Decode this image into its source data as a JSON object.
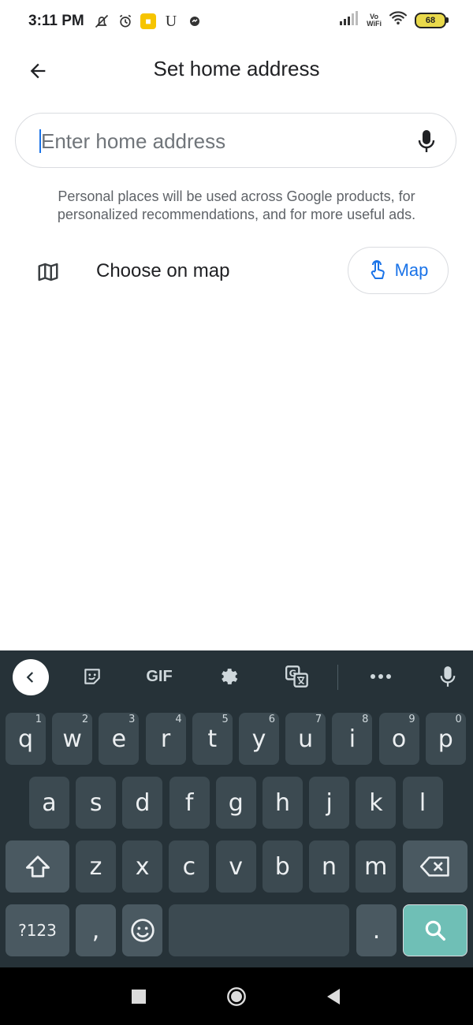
{
  "status_bar": {
    "time": "3:11 PM",
    "left_icons": [
      "mute-icon",
      "alarm-icon",
      "notification-icon",
      "u-icon",
      "messenger-icon"
    ],
    "vo_wifi_top": "Vo",
    "vo_wifi_bottom": "WiFi",
    "battery": "68"
  },
  "header": {
    "title": "Set home address"
  },
  "search": {
    "placeholder": "Enter home address",
    "value": ""
  },
  "disclaimer": "Personal places will be used across Google products, for personalized recommendations, and for more useful ads.",
  "choose_on_map": {
    "label": "Choose on map",
    "button_label": "Map"
  },
  "keyboard": {
    "toolbar": {
      "gif": "GIF"
    },
    "row1": [
      {
        "k": "q",
        "h": "1"
      },
      {
        "k": "w",
        "h": "2"
      },
      {
        "k": "e",
        "h": "3"
      },
      {
        "k": "r",
        "h": "4"
      },
      {
        "k": "t",
        "h": "5"
      },
      {
        "k": "y",
        "h": "6"
      },
      {
        "k": "u",
        "h": "7"
      },
      {
        "k": "i",
        "h": "8"
      },
      {
        "k": "o",
        "h": "9"
      },
      {
        "k": "p",
        "h": "0"
      }
    ],
    "row2": [
      "a",
      "s",
      "d",
      "f",
      "g",
      "h",
      "j",
      "k",
      "l"
    ],
    "row3": [
      "z",
      "x",
      "c",
      "v",
      "b",
      "n",
      "m"
    ],
    "symbols_label": "?123",
    "comma": ",",
    "period": "."
  },
  "colors": {
    "accent": "#1a73e8",
    "keyboard_bg": "#263238",
    "key_bg": "#3c4a51",
    "search_key": "#6fbfb6"
  }
}
